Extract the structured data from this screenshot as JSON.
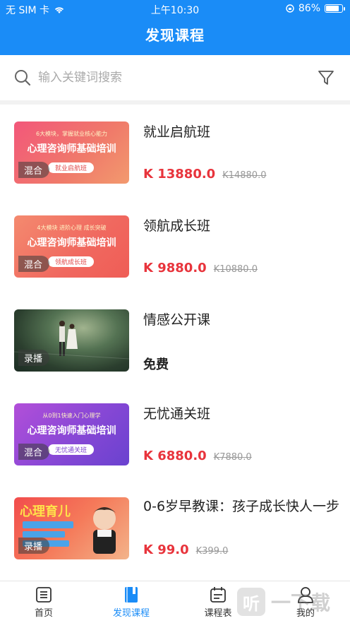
{
  "status_bar": {
    "carrier": "无 SIM 卡",
    "time": "上午10:30",
    "battery": "86%",
    "battery_level": 0.86
  },
  "header": {
    "title": "发现课程"
  },
  "search": {
    "placeholder": "输入关键词搜索"
  },
  "courses": [
    {
      "title": "就业启航班",
      "price": "K 13880.0",
      "original_price": "K14880.0",
      "mode": "混合",
      "thumb_title": "心理咨询师基础培训",
      "thumb_small": "6大模块，掌握就业核心能力",
      "thumb_pill": "就业启航班"
    },
    {
      "title": "领航成长班",
      "price": "K 9880.0",
      "original_price": "K10880.0",
      "mode": "混合",
      "thumb_title": "心理咨询师基础培训",
      "thumb_small": "4大模块  进阶心理  成长突破",
      "thumb_pill": "领航成长班"
    },
    {
      "title": "情感公开课",
      "price": "免费",
      "mode": "录播"
    },
    {
      "title": "无忧通关班",
      "price": "K 6880.0",
      "original_price": "K7880.0",
      "mode": "混合",
      "thumb_title": "心理咨询师基础培训",
      "thumb_small": "从0到1快速入门心理学",
      "thumb_pill": "无忧通关班"
    },
    {
      "title": "0-6岁早教课：孩子成长快人一步",
      "price": "K 99.0",
      "original_price": "K399.0",
      "mode": "录播",
      "thumb_title": "心理育儿"
    }
  ],
  "bottom_nav": {
    "items": [
      {
        "label": "首页",
        "icon": "home-list-icon"
      },
      {
        "label": "发现课程",
        "icon": "book-icon",
        "active": true
      },
      {
        "label": "课程表",
        "icon": "schedule-icon"
      },
      {
        "label": "我的",
        "icon": "user-icon"
      }
    ]
  },
  "watermark": {
    "text": "一下载",
    "glyph": "听"
  },
  "colors": {
    "primary": "#1a8cf7",
    "price": "#e8343c"
  }
}
